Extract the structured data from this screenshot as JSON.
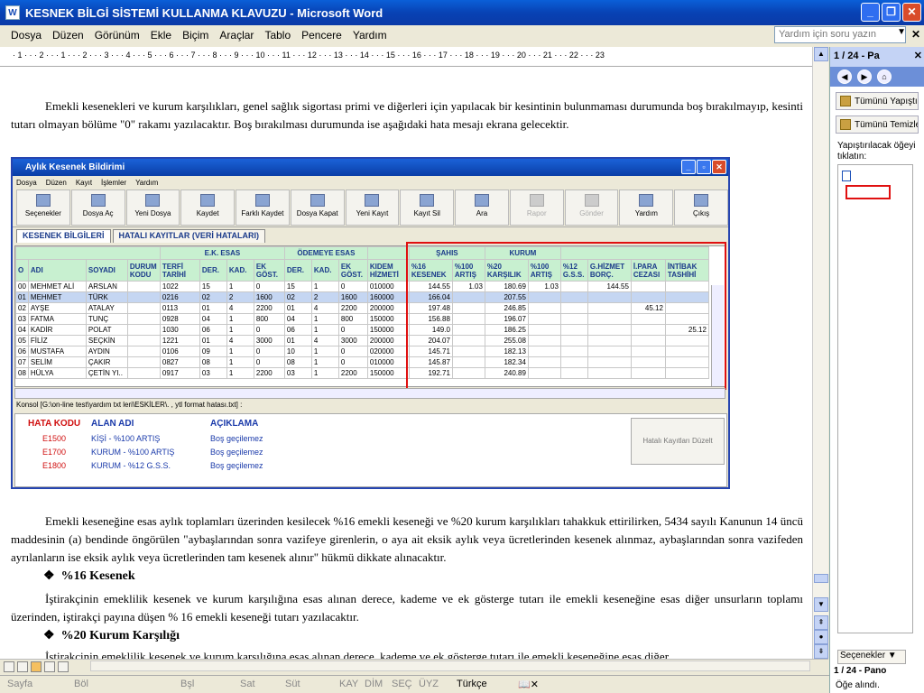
{
  "window": {
    "title": "KESNEK BİLGİ SİSTEMİ KULLANMA KLAVUZU - Microsoft Word",
    "app_icon": "W"
  },
  "menu": [
    "Dosya",
    "Düzen",
    "Görünüm",
    "Ekle",
    "Biçim",
    "Araçlar",
    "Tablo",
    "Pencere",
    "Yardım"
  ],
  "help_box_placeholder": "Yardım için soru yazın",
  "ruler_text": "· 1 · · · 2 · · · 1 · · · 2 · · · 3 · · · 4 · · · 5 · · · 6 · · · 7 · · · 8 · · · 9 · · · 10 · · · 11 · · · 12 · · · 13 · · · 14 · · · 15 · · · 16 · · · 17 · · · 18 · · · 19 · · · 20 · · · 21 · · · 22 · · · 23",
  "document": {
    "para1": "Emekli kesenekleri ve kurum karşılıkları, genel sağlık sigortası primi ve diğerleri için yapılacak bir kesintinin bulunmaması durumunda boş bırakılmayıp, kesinti tutarı olmayan bölüme \"0\" rakamı yazılacaktır. Boş bırakılması durumunda ise aşağıdaki hata mesajı ekrana gelecektir.",
    "para2": "Emekli keseneğine esas aylık toplamları üzerinden kesilecek %16 emekli keseneği ve %20 kurum karşılıkları tahakkuk ettirilirken, 5434 sayılı Kanunun 14 üncü maddesinin (a) bendinde öngörülen \"aybaşlarından sonra vazifeye girenlerin, o aya ait eksik aylık veya ücretlerinden kesenek alınmaz, aybaşlarından sonra vazifeden ayrılanların ise eksik aylık veya ücretlerinden tam kesenek alınır\" hükmü dikkate alınacaktır.",
    "heading1": "%16 Kesenek",
    "para3": "İştirakçinin emeklilik kesenek ve kurum karşılığına esas alınan derece, kademe ve ek gösterge tutarı ile emekli keseneğine esas diğer unsurların toplamı üzerinden, iştirakçi payına düşen % 16 emekli keseneği tutarı yazılacaktır.",
    "heading2": "%20 Kurum Karşılığı",
    "para4": "İştirakçinin emeklilik kesenek ve kurum karşılığına esas alınan derece, kademe ve ek gösterge tutarı ile emekli keseneğine esas diğer",
    "bullet": "❖"
  },
  "embedded": {
    "title": "Aylık Kesenek Bildirimi",
    "menu": [
      "Dosya",
      "Düzen",
      "Kayıt",
      "İşlemler",
      "Yardım"
    ],
    "tools": [
      {
        "label": "Seçenekler",
        "enabled": true
      },
      {
        "label": "Dosya Aç",
        "enabled": true
      },
      {
        "label": "Yeni Dosya",
        "enabled": true
      },
      {
        "label": "Kaydet",
        "enabled": true
      },
      {
        "label": "Farklı Kaydet",
        "enabled": true
      },
      {
        "label": "Dosya Kapat",
        "enabled": true
      },
      {
        "label": "Yeni Kayıt",
        "enabled": true
      },
      {
        "label": "Kayıt Sil",
        "enabled": true
      },
      {
        "label": "Ara",
        "enabled": true
      },
      {
        "label": "Rapor",
        "enabled": false
      },
      {
        "label": "Gönder",
        "enabled": false
      },
      {
        "label": "Yardım",
        "enabled": true
      },
      {
        "label": "Çıkış",
        "enabled": true
      }
    ],
    "tabs": [
      "KESENEK BİLGİLERİ",
      "HATALI KAYITLAR (VERİ HATALARI)"
    ],
    "group_headers": [
      "E.K. ESAS",
      "ÖDEMEYE ESAS",
      "ŞAHIS",
      "KURUM"
    ],
    "columns": [
      "O",
      "ADI",
      "SOYADI",
      "DURUM KODU",
      "TERFİ TARİHİ",
      "DER.",
      "KAD.",
      "EK GÖST.",
      "DER.",
      "KAD.",
      "EK GÖST.",
      "KIDEM HİZMETİ",
      "%16 KESENEK",
      "%100 ARTIŞ",
      "%20 KARŞILIK",
      "%100 ARTIŞ",
      "%12 G.S.S.",
      "G.HİZMET BORÇ.",
      "İ.PARA CEZASI",
      "İNTİBAK TASHİHİ"
    ],
    "rows": [
      [
        "00",
        "MEHMET ALİ",
        "ARSLAN",
        "",
        "1022",
        "15",
        "1",
        "0",
        "15",
        "1",
        "0",
        "010000",
        "144.55",
        "1.03",
        "180.69",
        "1.03",
        "",
        "144.55",
        "",
        ""
      ],
      [
        "01",
        "MEHMET",
        "TÜRK",
        "",
        "0216",
        "02",
        "2",
        "1600",
        "02",
        "2",
        "1600",
        "160000",
        "166.04",
        "",
        "207.55",
        "",
        "",
        "",
        "",
        ""
      ],
      [
        "02",
        "AYŞE",
        "ATALAY",
        "",
        "0113",
        "01",
        "4",
        "2200",
        "01",
        "4",
        "2200",
        "200000",
        "197.48",
        "",
        "246.85",
        "",
        "",
        "",
        "45.12",
        ""
      ],
      [
        "03",
        "FATMA",
        "TUNÇ",
        "",
        "0928",
        "04",
        "1",
        "800",
        "04",
        "1",
        "800",
        "150000",
        "156.88",
        "",
        "196.07",
        "",
        "",
        "",
        "",
        ""
      ],
      [
        "04",
        "KADİR",
        "POLAT",
        "",
        "1030",
        "06",
        "1",
        "0",
        "06",
        "1",
        "0",
        "150000",
        "149.0",
        "",
        "186.25",
        "",
        "",
        "",
        "",
        "25.12"
      ],
      [
        "05",
        "FİLİZ",
        "SEÇKİN",
        "",
        "1221",
        "01",
        "4",
        "3000",
        "01",
        "4",
        "3000",
        "200000",
        "204.07",
        "",
        "255.08",
        "",
        "",
        "",
        "",
        ""
      ],
      [
        "06",
        "MUSTAFA",
        "AYDIN",
        "",
        "0106",
        "09",
        "1",
        "0",
        "10",
        "1",
        "0",
        "020000",
        "145.71",
        "",
        "182.13",
        "",
        "",
        "",
        "",
        ""
      ],
      [
        "07",
        "SELİM",
        "ÇAKIR",
        "",
        "0827",
        "08",
        "1",
        "0",
        "08",
        "1",
        "0",
        "010000",
        "145.87",
        "",
        "182.34",
        "",
        "",
        "",
        "",
        ""
      ],
      [
        "08",
        "HÜLYA",
        "ÇETİN YI..",
        "",
        "0917",
        "03",
        "1",
        "2200",
        "03",
        "1",
        "2200",
        "150000",
        "192.71",
        "",
        "240.89",
        "",
        "",
        "",
        "",
        ""
      ]
    ],
    "konsol": "Konsol [G:\\on-line test\\yardım txt leri\\ESKİLER\\. , ytl format hatası.txt] :",
    "errors": {
      "headers": [
        "HATA KODU",
        "ALAN ADI",
        "AÇIKLAMA"
      ],
      "rows": [
        [
          "E1500",
          "KİŞİ - %100 ARTIŞ",
          "Boş geçilemez"
        ],
        [
          "E1700",
          "KURUM - %100 ARTIŞ",
          "Boş geçilemez"
        ],
        [
          "E1800",
          "KURUM - %12 G.S.S.",
          "Boş geçilemez"
        ]
      ],
      "fix_button": "Hatalı Kayıtları Düzelt"
    }
  },
  "taskpane": {
    "title": "1 / 24 - Pa",
    "paste_all": "Tümünü Yapıştır",
    "clear_all": "Tümünü Temizle",
    "hint": "Yapıştırılacak öğeyi tıklatın:",
    "options": "Seçenekler",
    "footer1": "1 / 24 - Pano",
    "footer2": "Öğe alındı."
  },
  "status": {
    "items": [
      "Sayfa",
      "Böl",
      "Bşl",
      "Sat",
      "Süt",
      "KAY",
      "DİM",
      "SEÇ",
      "ÜYZ"
    ],
    "language": "Türkçe"
  },
  "colors": {
    "titlebar": "#0842b4",
    "highlight": "#e01010",
    "header_green": "#c8f0d0",
    "link_blue": "#1a3aaa"
  }
}
